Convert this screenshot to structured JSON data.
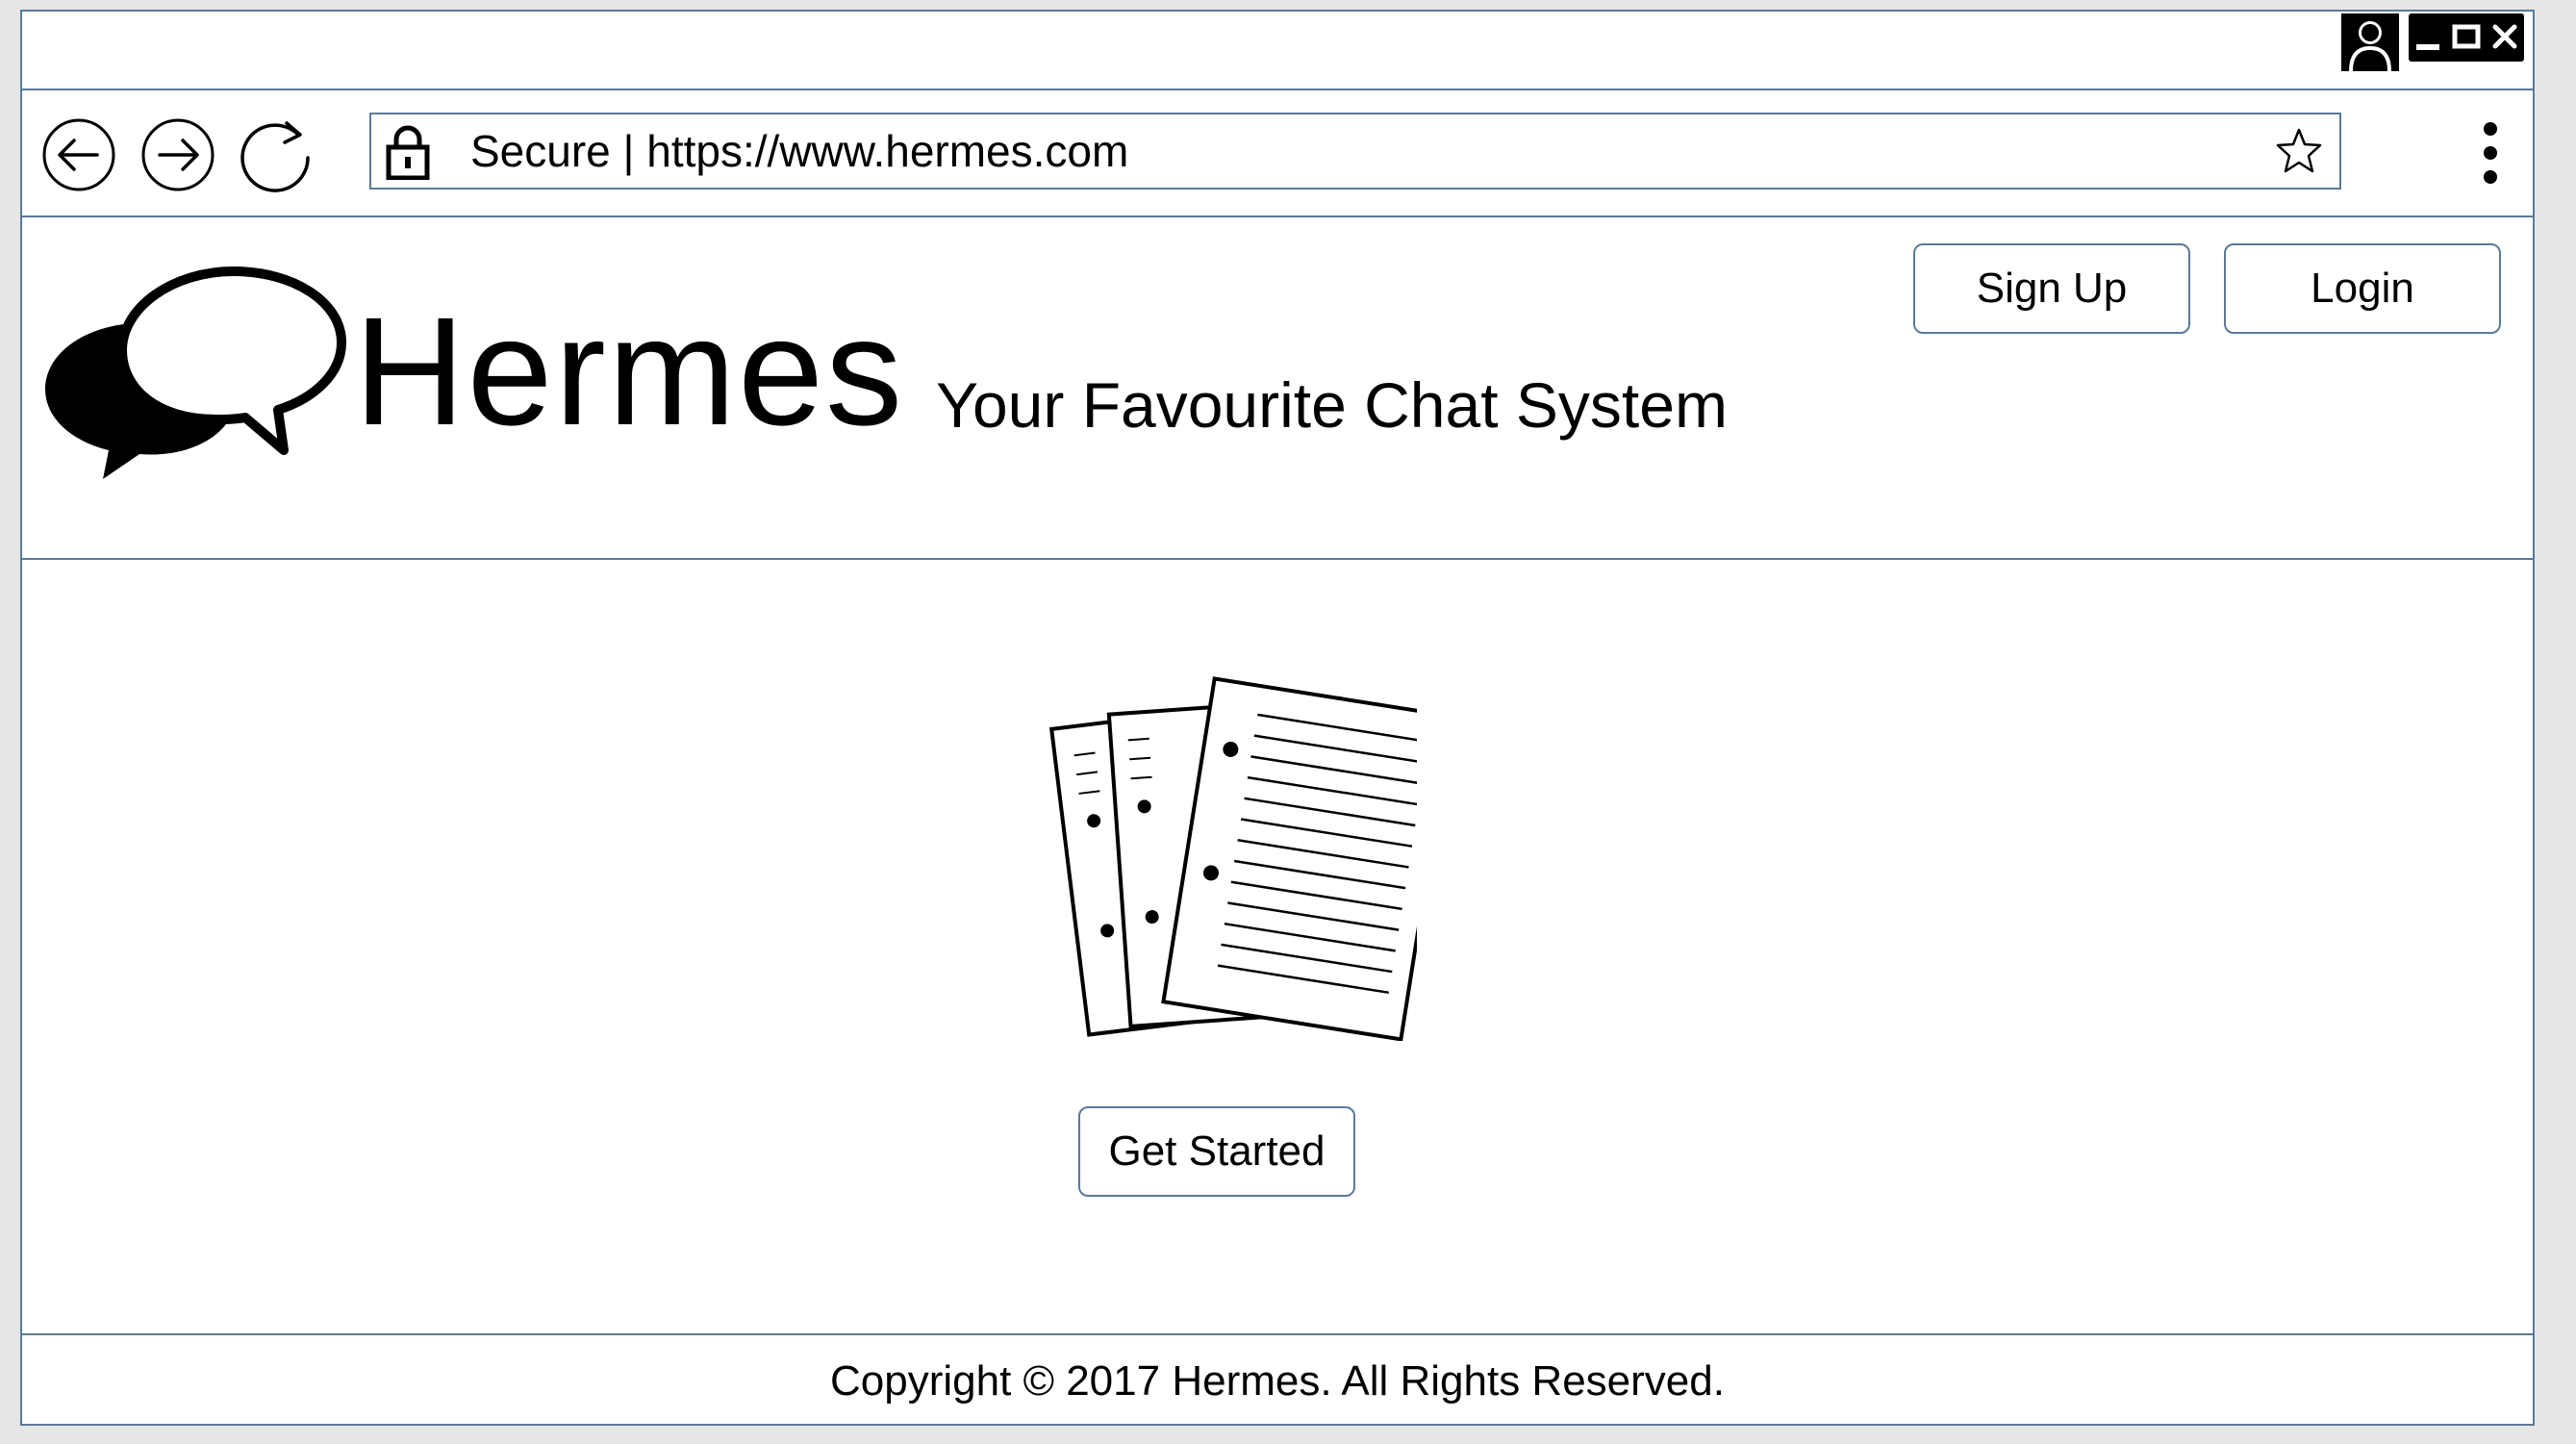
{
  "browser": {
    "address_bar": {
      "secure_label": "Secure",
      "separator": "|",
      "url": "https://www.hermes.com"
    },
    "icons": {
      "back": "back-arrow-icon",
      "forward": "forward-arrow-icon",
      "reload": "reload-icon",
      "lock": "lock-icon",
      "bookmark": "star-icon",
      "menu": "kebab-menu-icon",
      "user": "user-profile-icon",
      "minimize": "minimize-icon",
      "maximize": "maximize-icon",
      "close": "close-icon"
    }
  },
  "header": {
    "brand": "Hermes",
    "tagline": "Your Favourite Chat System",
    "logo_icon": "chat-bubbles-icon",
    "signup_label": "Sign Up",
    "login_label": "Login"
  },
  "main": {
    "illustration_icon": "documents-icon",
    "get_started_label": "Get Started"
  },
  "footer": {
    "copyright": "Copyright © 2017 Hermes. All Rights Reserved."
  },
  "colors": {
    "border": "#5a7a9a",
    "background": "#ffffff",
    "outer_background": "#e6e6e6",
    "text": "#000000"
  }
}
